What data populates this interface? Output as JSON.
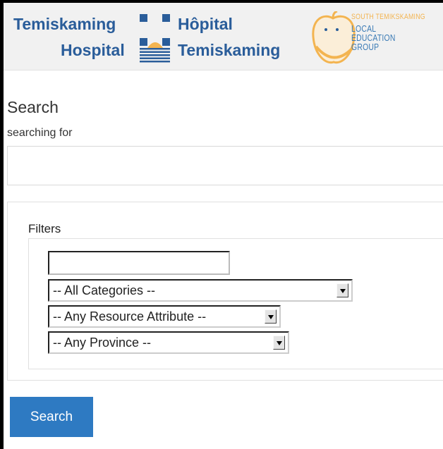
{
  "header": {
    "hospital_en_line1": "Temiskaming",
    "hospital_en_line2": "Hospital",
    "hospital_fr_line1": "Hôpital",
    "hospital_fr_line2": "Temiskaming",
    "hospital_logo_icon": "hospital-emblem-icon",
    "leg_logo_icon": "apple-logo-icon",
    "leg_line1": "SOUTH TEMIKSKAMING",
    "leg_line2": "LOCAL",
    "leg_line3": "EDUCATION",
    "leg_line4": "GROUP",
    "brand_color": "#2a5d9a",
    "leg_color": "#f3b450"
  },
  "search": {
    "heading": "Search",
    "searching_for_label": "searching for",
    "query_value": ""
  },
  "filters": {
    "label": "Filters",
    "keyword_value": "",
    "category_selected": "-- All Categories --",
    "attribute_selected": "-- Any Resource Attribute --",
    "province_selected": "-- Any Province --"
  },
  "actions": {
    "search_button_label": "Search",
    "button_color": "#2e7ac2"
  }
}
